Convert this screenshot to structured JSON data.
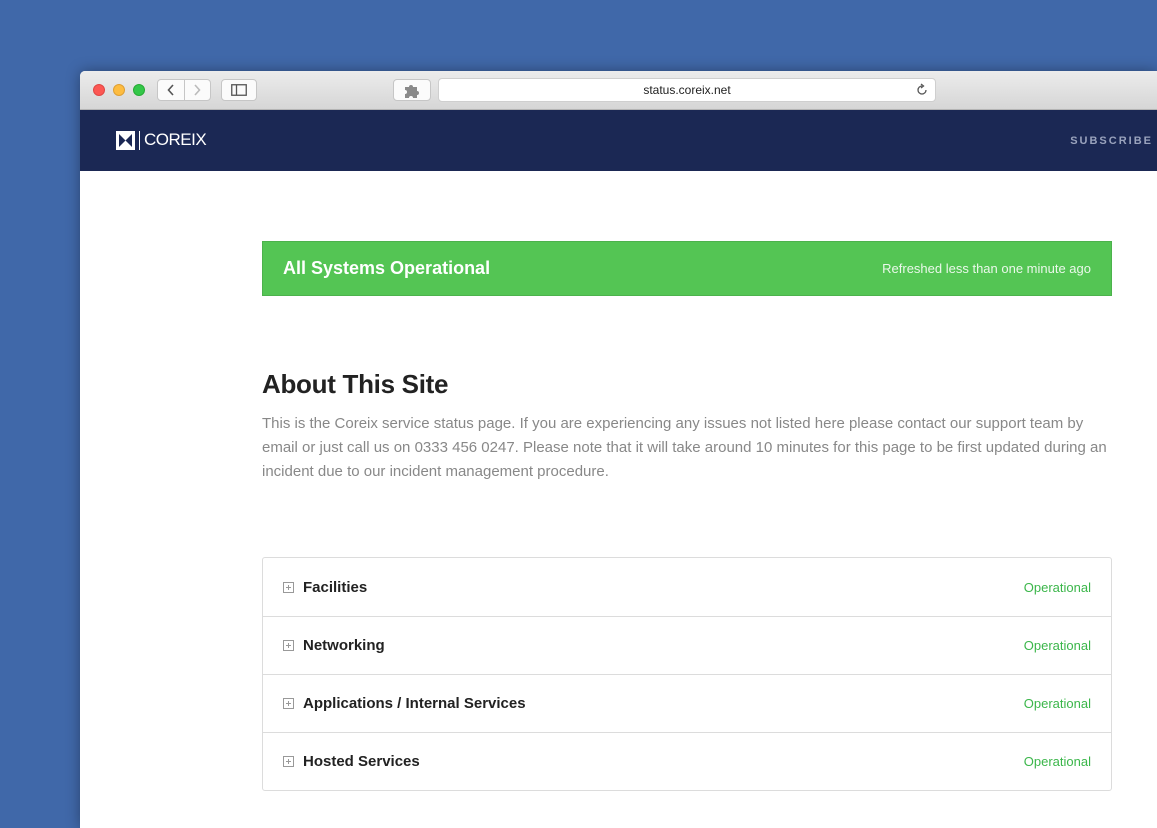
{
  "browser": {
    "url": "status.coreix.net"
  },
  "header": {
    "logo_text": "COREIX",
    "subscribe_label": "SUBSCRIBE"
  },
  "banner": {
    "title": "All Systems Operational",
    "refresh_text": "Refreshed less than one minute ago",
    "color": "#54c554"
  },
  "about": {
    "title": "About This Site",
    "description": "This is the Coreix service status page. If you are experiencing any issues not listed here please contact our support team by email or just call us on 0333 456 0247. Please note that it will take around 10 minutes for this page to be first updated during an incident due to our incident management procedure."
  },
  "components": [
    {
      "name": "Facilities",
      "status": "Operational"
    },
    {
      "name": "Networking",
      "status": "Operational"
    },
    {
      "name": "Applications / Internal Services",
      "status": "Operational"
    },
    {
      "name": "Hosted Services",
      "status": "Operational"
    }
  ],
  "icons": {
    "expand": "plus-square-icon",
    "back": "chevron-left-icon",
    "forward": "chevron-right-icon",
    "sidebar": "sidebar-icon",
    "extension": "puzzle-icon",
    "reload": "reload-icon"
  },
  "colors": {
    "header_bg": "#1b2854",
    "status_green": "#3bb64a",
    "desktop_bg": "#4068a9"
  }
}
